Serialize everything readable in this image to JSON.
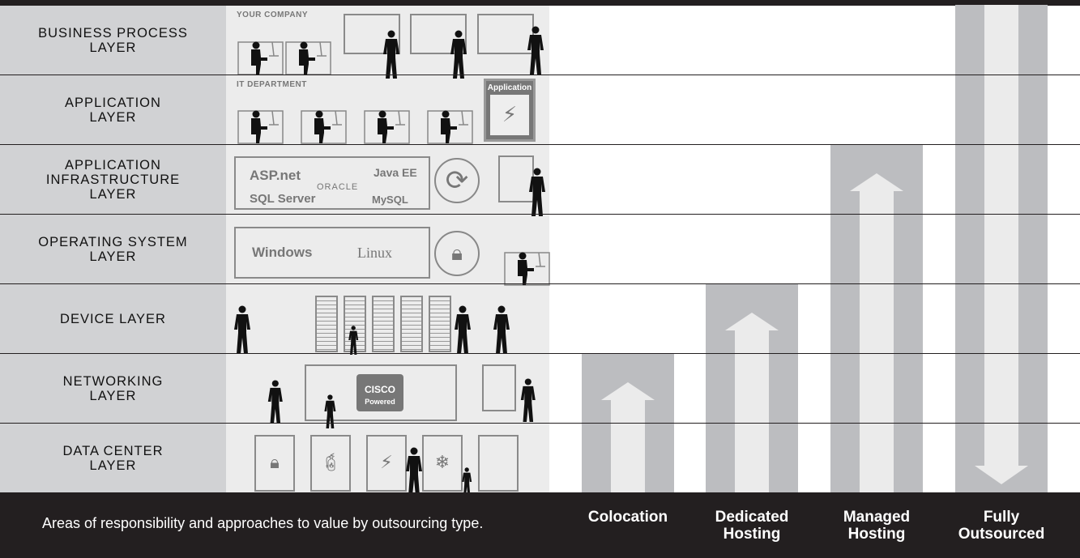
{
  "layers": [
    {
      "label": "BUSINESS PROCESS\nLAYER"
    },
    {
      "label": "APPLICATION\nLAYER"
    },
    {
      "label": "APPLICATION\nINFRASTRUCTURE\nLAYER"
    },
    {
      "label": "OPERATING SYSTEM\nLAYER"
    },
    {
      "label": "DEVICE  LAYER"
    },
    {
      "label": "NETWORKING\nLAYER"
    },
    {
      "label": "DATA CENTER\nLAYER"
    }
  ],
  "illustration": {
    "your_company": "YOUR COMPANY",
    "it_department": "IT DEPARTMENT",
    "application_box": "Application",
    "logos": {
      "aspnet": "ASP.net",
      "java": "Java EE",
      "oracle": "ORACLE",
      "sqlserver": "SQL Server",
      "mysql": "MySQL",
      "windows": "Windows",
      "linux": "Linux",
      "cisco": "CISCO",
      "cisco_powered": "Powered"
    }
  },
  "outsourcing_types": [
    {
      "label": "Colocation",
      "covers_layers_from_bottom": 2,
      "arrow": "up"
    },
    {
      "label": "Dedicated\nHosting",
      "covers_layers_from_bottom": 3,
      "arrow": "up"
    },
    {
      "label": "Managed\nHosting",
      "covers_layers_from_bottom": 5,
      "arrow": "up"
    },
    {
      "label": "Fully\nOutsourced",
      "covers_layers_from_bottom": 7,
      "arrow": "down"
    }
  ],
  "caption": "Areas of responsibility and approaches to value by outsourcing type.",
  "colors": {
    "dark": "#231f20",
    "column": "#bcbdc0",
    "stripe": "#ebebeb",
    "label_bg": "#d1d2d4"
  }
}
